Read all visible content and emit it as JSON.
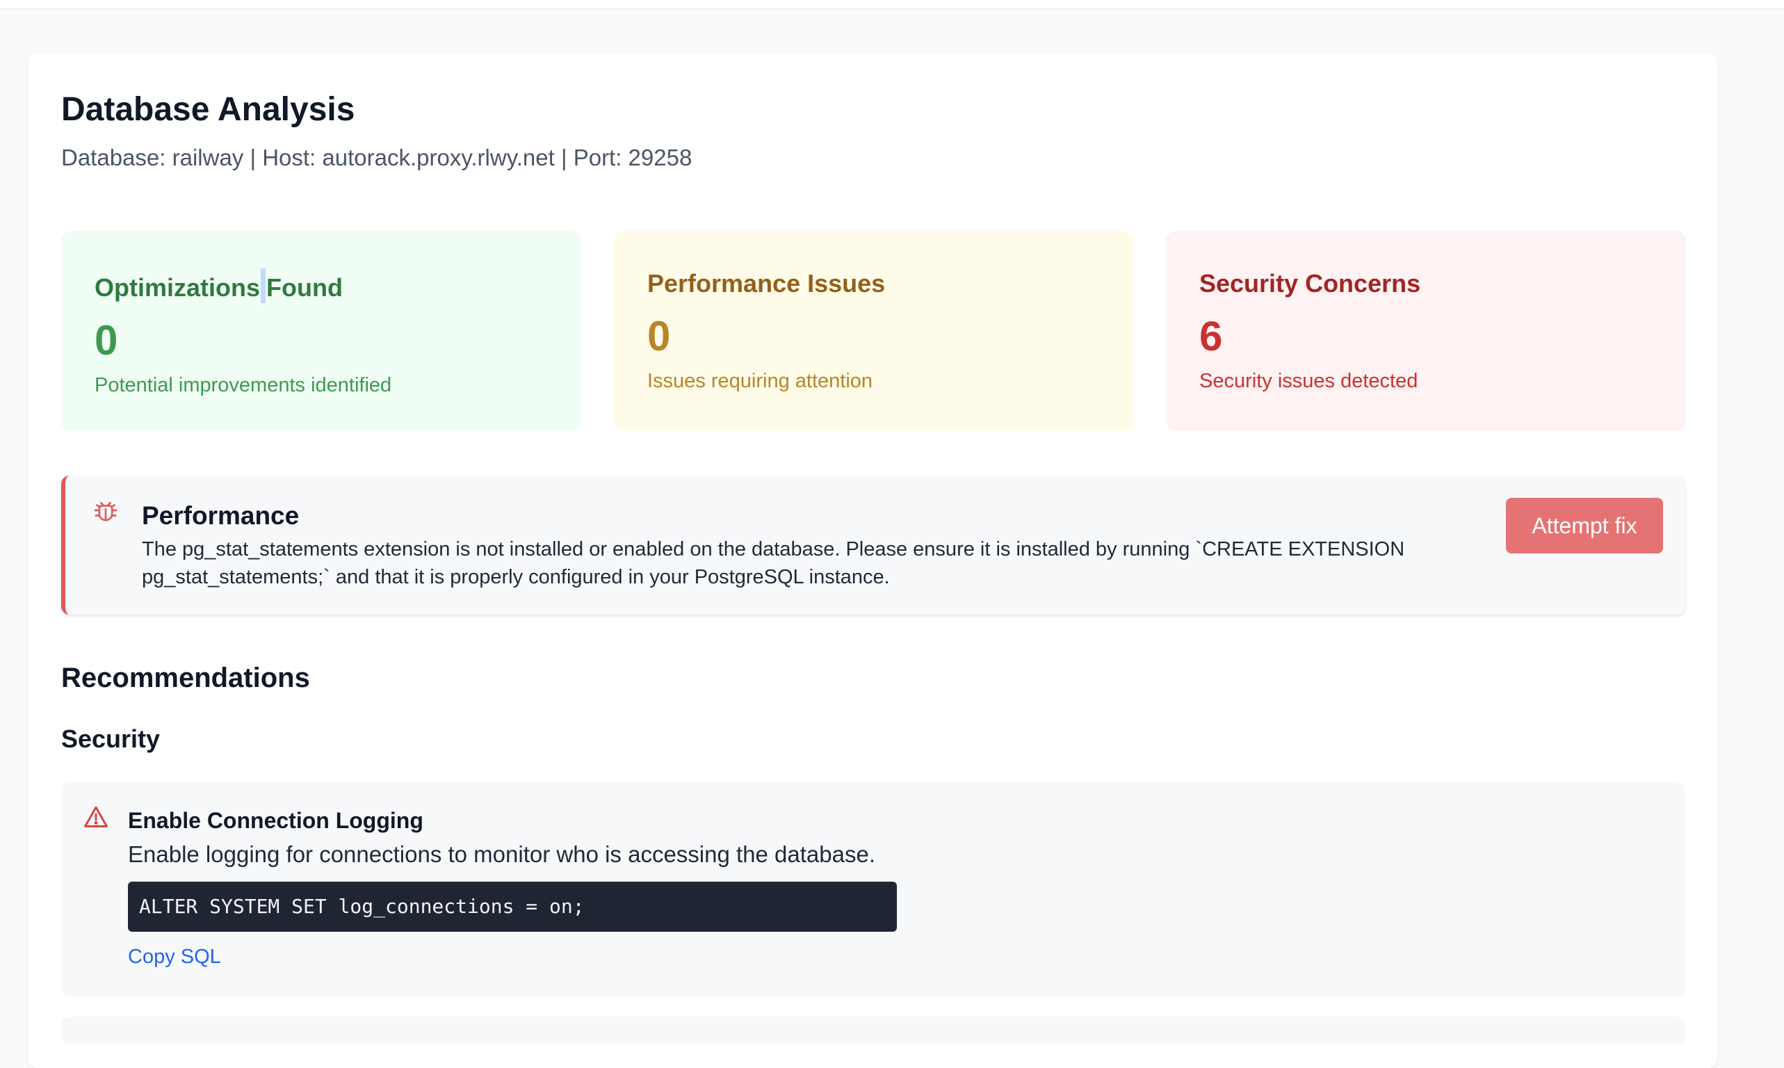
{
  "header": {
    "title": "Database Analysis",
    "subtitle": "Database: railway | Host: autorack.proxy.rlwy.net | Port: 29258"
  },
  "stats": [
    {
      "title_part1": "Optimizations",
      "title_part2": "Found",
      "value": "0",
      "description": "Potential improvements identified",
      "color": "#3d9a50"
    },
    {
      "title": "Performance Issues",
      "value": "0",
      "description": "Issues requiring attention",
      "color": "#b8852a"
    },
    {
      "title": "Security Concerns",
      "value": "6",
      "description": "Security issues detected",
      "color": "#c83232"
    }
  ],
  "alert": {
    "icon": "bug-icon",
    "title": "Performance",
    "message": "The pg_stat_statements extension is not installed or enabled on the database. Please ensure it is installed by running `CREATE EXTENSION pg_stat_statements;` and that it is properly configured in your PostgreSQL instance.",
    "button_label": "Attempt fix",
    "accent": "#e05a5a"
  },
  "recommendations": {
    "heading": "Recommendations",
    "category": "Security",
    "items": [
      {
        "icon": "warning-triangle-icon",
        "title": "Enable Connection Logging",
        "description": "Enable logging for connections to monitor who is accessing the database.",
        "sql": "ALTER SYSTEM SET log_connections = on;",
        "copy_label": "Copy SQL"
      }
    ]
  }
}
